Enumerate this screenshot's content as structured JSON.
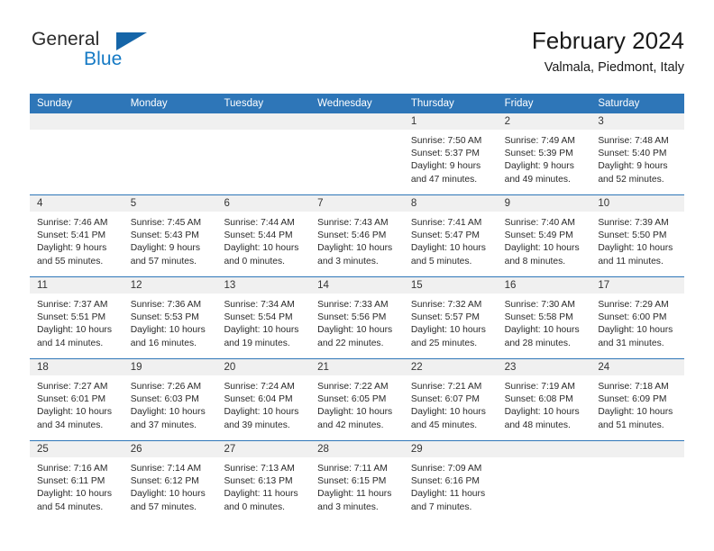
{
  "brand": {
    "name_part1": "General",
    "name_part2": "Blue"
  },
  "header": {
    "title": "February 2024",
    "location": "Valmala, Piedmont, Italy"
  },
  "colors": {
    "header_blue": "#2e76b8",
    "brand_blue": "#1479c4",
    "day_band_gray": "#f0f0f0"
  },
  "weekdays": [
    "Sunday",
    "Monday",
    "Tuesday",
    "Wednesday",
    "Thursday",
    "Friday",
    "Saturday"
  ],
  "weeks": [
    [
      {
        "day": "",
        "empty": true
      },
      {
        "day": "",
        "empty": true
      },
      {
        "day": "",
        "empty": true
      },
      {
        "day": "",
        "empty": true
      },
      {
        "day": "1",
        "sunrise": "Sunrise: 7:50 AM",
        "sunset": "Sunset: 5:37 PM",
        "daylight1": "Daylight: 9 hours",
        "daylight2": "and 47 minutes."
      },
      {
        "day": "2",
        "sunrise": "Sunrise: 7:49 AM",
        "sunset": "Sunset: 5:39 PM",
        "daylight1": "Daylight: 9 hours",
        "daylight2": "and 49 minutes."
      },
      {
        "day": "3",
        "sunrise": "Sunrise: 7:48 AM",
        "sunset": "Sunset: 5:40 PM",
        "daylight1": "Daylight: 9 hours",
        "daylight2": "and 52 minutes."
      }
    ],
    [
      {
        "day": "4",
        "sunrise": "Sunrise: 7:46 AM",
        "sunset": "Sunset: 5:41 PM",
        "daylight1": "Daylight: 9 hours",
        "daylight2": "and 55 minutes."
      },
      {
        "day": "5",
        "sunrise": "Sunrise: 7:45 AM",
        "sunset": "Sunset: 5:43 PM",
        "daylight1": "Daylight: 9 hours",
        "daylight2": "and 57 minutes."
      },
      {
        "day": "6",
        "sunrise": "Sunrise: 7:44 AM",
        "sunset": "Sunset: 5:44 PM",
        "daylight1": "Daylight: 10 hours",
        "daylight2": "and 0 minutes."
      },
      {
        "day": "7",
        "sunrise": "Sunrise: 7:43 AM",
        "sunset": "Sunset: 5:46 PM",
        "daylight1": "Daylight: 10 hours",
        "daylight2": "and 3 minutes."
      },
      {
        "day": "8",
        "sunrise": "Sunrise: 7:41 AM",
        "sunset": "Sunset: 5:47 PM",
        "daylight1": "Daylight: 10 hours",
        "daylight2": "and 5 minutes."
      },
      {
        "day": "9",
        "sunrise": "Sunrise: 7:40 AM",
        "sunset": "Sunset: 5:49 PM",
        "daylight1": "Daylight: 10 hours",
        "daylight2": "and 8 minutes."
      },
      {
        "day": "10",
        "sunrise": "Sunrise: 7:39 AM",
        "sunset": "Sunset: 5:50 PM",
        "daylight1": "Daylight: 10 hours",
        "daylight2": "and 11 minutes."
      }
    ],
    [
      {
        "day": "11",
        "sunrise": "Sunrise: 7:37 AM",
        "sunset": "Sunset: 5:51 PM",
        "daylight1": "Daylight: 10 hours",
        "daylight2": "and 14 minutes."
      },
      {
        "day": "12",
        "sunrise": "Sunrise: 7:36 AM",
        "sunset": "Sunset: 5:53 PM",
        "daylight1": "Daylight: 10 hours",
        "daylight2": "and 16 minutes."
      },
      {
        "day": "13",
        "sunrise": "Sunrise: 7:34 AM",
        "sunset": "Sunset: 5:54 PM",
        "daylight1": "Daylight: 10 hours",
        "daylight2": "and 19 minutes."
      },
      {
        "day": "14",
        "sunrise": "Sunrise: 7:33 AM",
        "sunset": "Sunset: 5:56 PM",
        "daylight1": "Daylight: 10 hours",
        "daylight2": "and 22 minutes."
      },
      {
        "day": "15",
        "sunrise": "Sunrise: 7:32 AM",
        "sunset": "Sunset: 5:57 PM",
        "daylight1": "Daylight: 10 hours",
        "daylight2": "and 25 minutes."
      },
      {
        "day": "16",
        "sunrise": "Sunrise: 7:30 AM",
        "sunset": "Sunset: 5:58 PM",
        "daylight1": "Daylight: 10 hours",
        "daylight2": "and 28 minutes."
      },
      {
        "day": "17",
        "sunrise": "Sunrise: 7:29 AM",
        "sunset": "Sunset: 6:00 PM",
        "daylight1": "Daylight: 10 hours",
        "daylight2": "and 31 minutes."
      }
    ],
    [
      {
        "day": "18",
        "sunrise": "Sunrise: 7:27 AM",
        "sunset": "Sunset: 6:01 PM",
        "daylight1": "Daylight: 10 hours",
        "daylight2": "and 34 minutes."
      },
      {
        "day": "19",
        "sunrise": "Sunrise: 7:26 AM",
        "sunset": "Sunset: 6:03 PM",
        "daylight1": "Daylight: 10 hours",
        "daylight2": "and 37 minutes."
      },
      {
        "day": "20",
        "sunrise": "Sunrise: 7:24 AM",
        "sunset": "Sunset: 6:04 PM",
        "daylight1": "Daylight: 10 hours",
        "daylight2": "and 39 minutes."
      },
      {
        "day": "21",
        "sunrise": "Sunrise: 7:22 AM",
        "sunset": "Sunset: 6:05 PM",
        "daylight1": "Daylight: 10 hours",
        "daylight2": "and 42 minutes."
      },
      {
        "day": "22",
        "sunrise": "Sunrise: 7:21 AM",
        "sunset": "Sunset: 6:07 PM",
        "daylight1": "Daylight: 10 hours",
        "daylight2": "and 45 minutes."
      },
      {
        "day": "23",
        "sunrise": "Sunrise: 7:19 AM",
        "sunset": "Sunset: 6:08 PM",
        "daylight1": "Daylight: 10 hours",
        "daylight2": "and 48 minutes."
      },
      {
        "day": "24",
        "sunrise": "Sunrise: 7:18 AM",
        "sunset": "Sunset: 6:09 PM",
        "daylight1": "Daylight: 10 hours",
        "daylight2": "and 51 minutes."
      }
    ],
    [
      {
        "day": "25",
        "sunrise": "Sunrise: 7:16 AM",
        "sunset": "Sunset: 6:11 PM",
        "daylight1": "Daylight: 10 hours",
        "daylight2": "and 54 minutes."
      },
      {
        "day": "26",
        "sunrise": "Sunrise: 7:14 AM",
        "sunset": "Sunset: 6:12 PM",
        "daylight1": "Daylight: 10 hours",
        "daylight2": "and 57 minutes."
      },
      {
        "day": "27",
        "sunrise": "Sunrise: 7:13 AM",
        "sunset": "Sunset: 6:13 PM",
        "daylight1": "Daylight: 11 hours",
        "daylight2": "and 0 minutes."
      },
      {
        "day": "28",
        "sunrise": "Sunrise: 7:11 AM",
        "sunset": "Sunset: 6:15 PM",
        "daylight1": "Daylight: 11 hours",
        "daylight2": "and 3 minutes."
      },
      {
        "day": "29",
        "sunrise": "Sunrise: 7:09 AM",
        "sunset": "Sunset: 6:16 PM",
        "daylight1": "Daylight: 11 hours",
        "daylight2": "and 7 minutes."
      },
      {
        "day": "",
        "empty": true
      },
      {
        "day": "",
        "empty": true
      }
    ]
  ]
}
